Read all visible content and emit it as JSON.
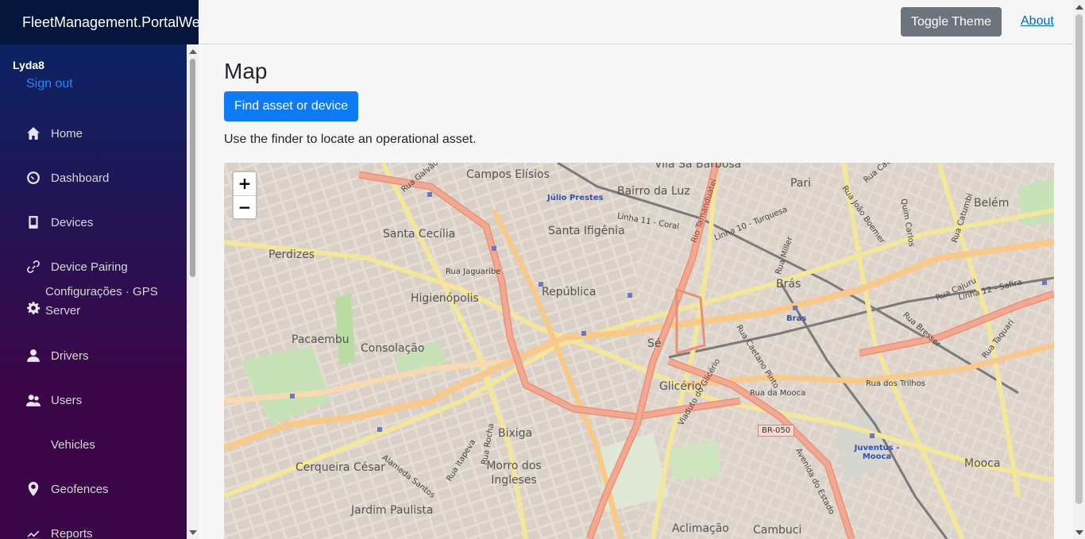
{
  "app": {
    "brand": "FleetManagement.PortalWeb"
  },
  "user": {
    "name": "Lyda8",
    "sign_out": "Sign out"
  },
  "nav": {
    "home": "Home",
    "dashboard": "Dashboard",
    "devices": "Devices",
    "device_pairing": "Device Pairing",
    "gps_config_line1": "Configurações · GPS",
    "gps_config_line2": "Server",
    "drivers": "Drivers",
    "users": "Users",
    "vehicles": "Vehicles",
    "geofences": "Geofences",
    "reports": "Reports"
  },
  "topbar": {
    "toggle_theme": "Toggle Theme",
    "about": "About"
  },
  "main": {
    "title": "Map",
    "find_button": "Find asset or device",
    "hint": "Use the finder to locate an operational asset."
  },
  "map": {
    "zoom_in": "+",
    "zoom_out": "−",
    "labels": {
      "campos_eliseos": "Campos Elísios",
      "vila_sa_barbosa": "Vila Sa Barbosa",
      "bairro_da_luz": "Bairro da Luz",
      "pari": "Pari",
      "belem": "Belém",
      "julio_prestes": "Júlio Prestes",
      "santa_cecilia": "Santa Cecília",
      "santa_ifigenia": "Santa Ifigênia",
      "perdizes": "Perdizes",
      "rua_jaguaribe": "Rua Jaguaribe",
      "higienopolis": "Higienópolis",
      "republica": "República",
      "bras": "Brás",
      "bras_station": "Brás",
      "pacaembu": "Pacaembu",
      "consolacao": "Consolação",
      "se": "Sé",
      "glicerio": "Glicério",
      "rua_da_mooca": "Rua da Mooca",
      "rua_dos_trilhos": "Rua dos Trilhos",
      "br050": "BR-050",
      "bixiga": "Bixiga",
      "juventus_mooca": "Juventus - Mooca",
      "mooca": "Mooca",
      "cerqueira_cesar": "Cerqueira César",
      "morro_dos_ingleses": "Morro dos Ingleses",
      "jardim_paulista": "Jardim Paulista",
      "aclimacao": "Aclimação",
      "cambuci": "Cambuci",
      "linha_10_turquesa": "Linha 10 - Turquesa",
      "linha_11_coral": "Linha 11 - Coral",
      "linha_12_safira": "Linha 12 - Safira",
      "avenida_do_estado": "Avenida do Estado",
      "viaduto_do_glicerio": "Viaduto do Glicério",
      "alameda_santos": "Alameda Santos",
      "rua_augusta": "Rua Itapeva",
      "rua_rocha": "Rua Rocha",
      "rua_cajuru": "Rua Cajuru",
      "rua_taquari": "Rua Taquari",
      "rua_bresser": "Rua Bresser",
      "rua_caetano_pinto": "Rua Caetano Pinto",
      "rua_miller": "Rua Miller",
      "rua_cachoeira": "Rua Cachoeira",
      "rua_joao_boemer": "Rua João Boemer",
      "rua_catumbi": "Rua Catumbi",
      "rua_galvao": "Rua Galvão",
      "quim_carlos": "Quim Carlos",
      "rio_tamanduatei": "Rio Tamanduateí"
    }
  }
}
